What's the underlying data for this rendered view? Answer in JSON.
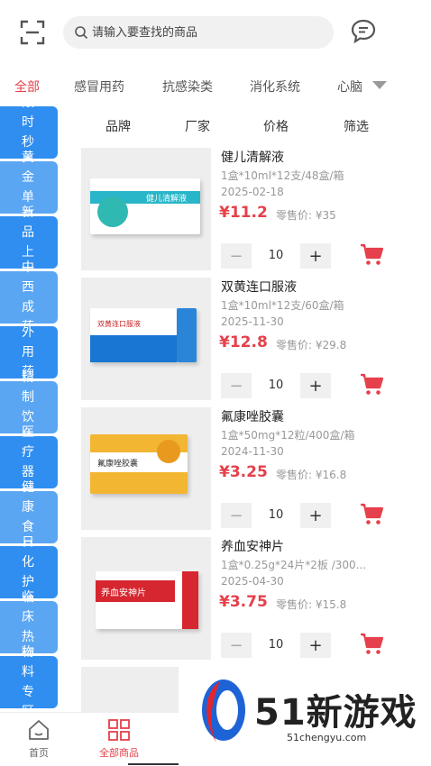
{
  "search": {
    "placeholder": "请输入要查找的商品"
  },
  "categories": [
    "全部",
    "感冒用药",
    "抗感染类",
    "消化系统",
    "心脑"
  ],
  "sidebar": [
    "限 时\n秒 杀",
    "黄 金\n单 品",
    "新 品\n上 市",
    "中 西\n成 药",
    "外 用\n药",
    "精 制\n饮 片",
    "医 疗\n器 械",
    "健 康\n食 品",
    "日 化\n护 理",
    "临 床\n热 销",
    "物 料\n专 区"
  ],
  "filters": [
    "品牌",
    "厂家",
    "价格",
    "筛选"
  ],
  "products": [
    {
      "name": "健儿清解液",
      "spec": "1盒*10ml*12支/48盒/箱",
      "date": "2025-02-18",
      "price": "¥11.2",
      "retail": "零售价: ¥35",
      "qty": "10",
      "box_label": "健儿清解液"
    },
    {
      "name": "双黄连口服液",
      "spec": "1盒*10ml*12支/60盒/箱",
      "date": "2025-11-30",
      "price": "¥12.8",
      "retail": "零售价: ¥29.8",
      "qty": "10",
      "box_label": "双黄连口服液"
    },
    {
      "name": "氟康唑胶囊",
      "spec": "1盒*50mg*12粒/400盒/箱",
      "date": "2024-11-30",
      "price": "¥3.25",
      "retail": "零售价: ¥16.8",
      "qty": "10",
      "box_label": "氟康唑胶囊"
    },
    {
      "name": "养血安神片",
      "spec": "1盒*0.25g*24片*2板 /300...",
      "date": "2025-04-30",
      "price": "¥3.75",
      "retail": "零售价: ¥15.8",
      "qty": "10",
      "box_label": "养血安神片"
    }
  ],
  "stepper": {
    "minus": "−",
    "plus": "+"
  },
  "bottom_nav": {
    "home": "首页",
    "all": "全部商品"
  },
  "watermark": {
    "title": "51新游戏",
    "url": "51chengyu.com"
  },
  "colors": {
    "accent": "#e5404b",
    "sidebar": "#2f8ef0"
  }
}
